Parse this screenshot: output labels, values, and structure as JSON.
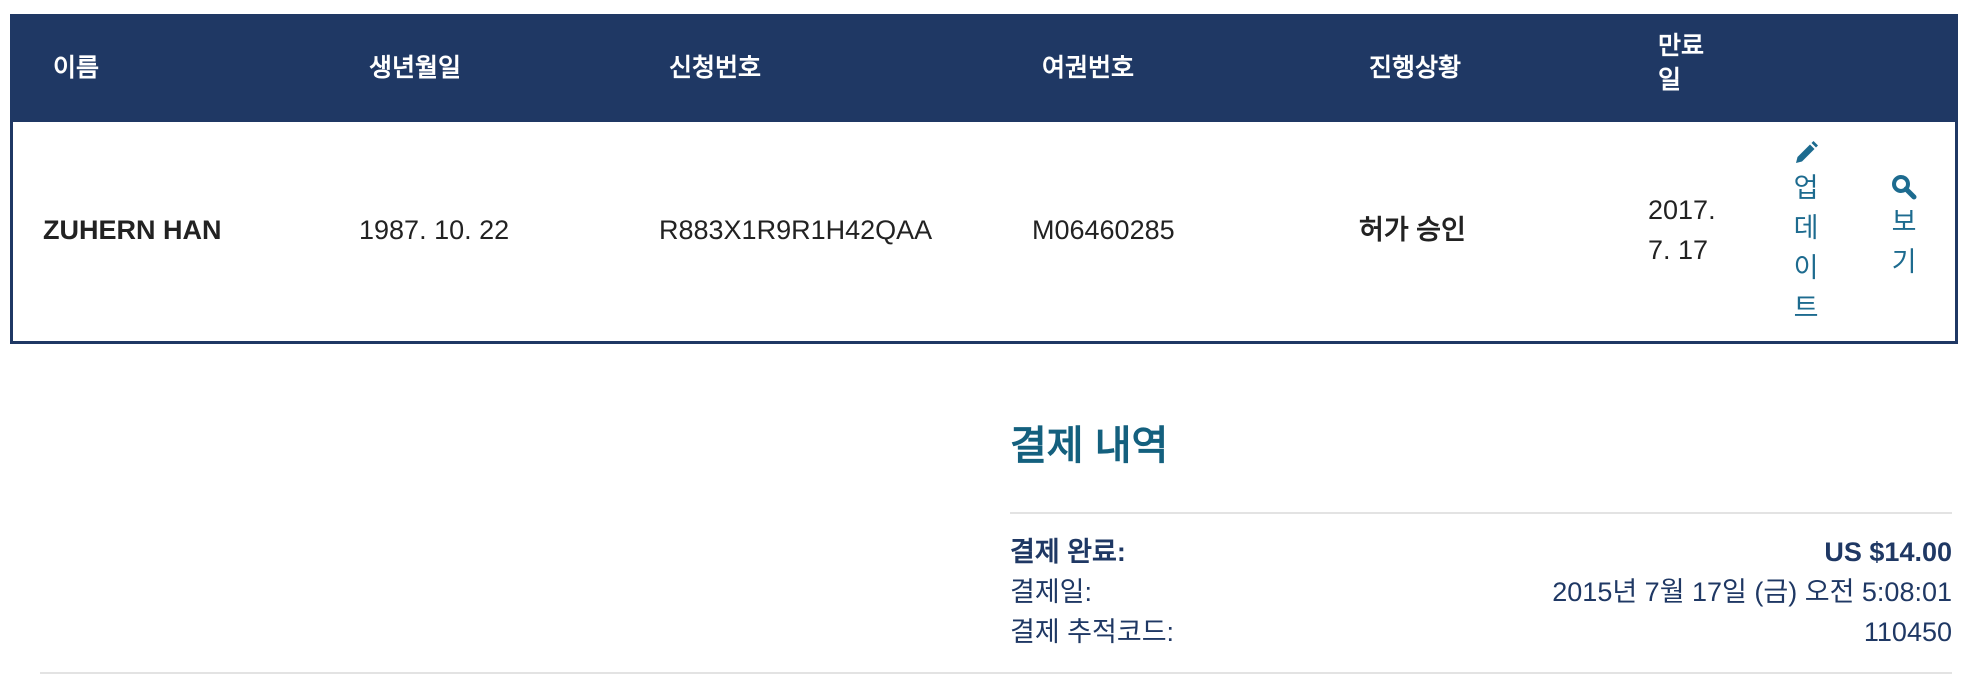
{
  "table": {
    "headers": {
      "name": "이름",
      "birth": "생년월일",
      "application_no": "신청번호",
      "passport_no": "여권번호",
      "status": "진행상황",
      "expiry_line1": "만료",
      "expiry_line2": "일"
    },
    "row": {
      "name": "ZUHERN HAN",
      "birth": "1987. 10. 22",
      "application_no": "R883X1R9R1H42QAA",
      "passport_no": "M06460285",
      "status": "허가 승인",
      "expiry_line1": "2017.",
      "expiry_line2": "7. 17"
    },
    "actions": {
      "update": {
        "icon": "pencil-icon",
        "chars": [
          "업",
          "데",
          "이",
          "트"
        ]
      },
      "view": {
        "icon": "search-icon",
        "chars": [
          "보",
          "기"
        ]
      }
    }
  },
  "payment": {
    "title": "결제 내역",
    "rows": [
      {
        "label": "결제 완료:",
        "value": "US $14.00"
      },
      {
        "label": "결제일:",
        "value": "2015년 7월 17일 (금) 오전 5:08:01"
      },
      {
        "label": "결제 추적코드:",
        "value": "110450"
      }
    ]
  },
  "colors": {
    "header_bg": "#1f3864",
    "link": "#1d6b8f",
    "title": "#14607e",
    "divider": "#e3e3e3"
  }
}
